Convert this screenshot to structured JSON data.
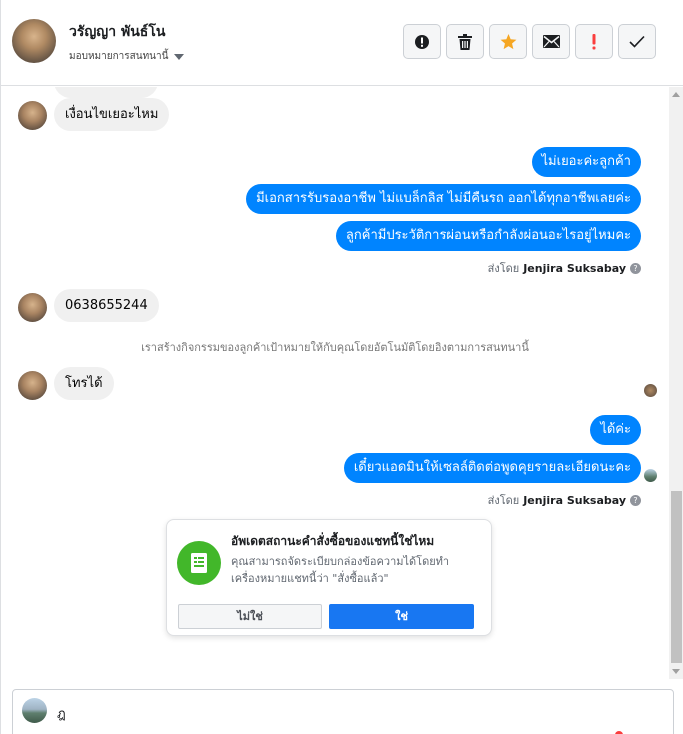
{
  "header": {
    "contact_name": "วรัญญา พันธ์โน",
    "assign_label": "มอบหมายการสนทนานี้"
  },
  "toolbar": {
    "buttons": [
      {
        "name": "spam-button",
        "icon": "alert-circle-icon"
      },
      {
        "name": "delete-button",
        "icon": "trash-icon"
      },
      {
        "name": "star-button",
        "icon": "star-icon",
        "color": "#f5a623"
      },
      {
        "name": "mark-unread-button",
        "icon": "envelope-icon"
      },
      {
        "name": "follow-up-button",
        "icon": "exclamation-icon",
        "color": "#fa3e3e"
      },
      {
        "name": "done-button",
        "icon": "checkmark-icon"
      }
    ]
  },
  "messages": {
    "in_1": "เงื่อนไขเยอะไหม",
    "out_1": "ไม่เยอะค่ะลูกค้า",
    "out_2": "มีเอกสารรับรองอาชีพ ไม่แบล็กลิส ไม่มีคืนรถ ออกได้ทุกอาชีพเลยค่ะ",
    "out_3": "ลูกค้ามีประวัติการผ่อนหรือกำลังผ่อนอะไรอยู่ไหมคะ",
    "sent_by_label_1": "ส่งโดย",
    "sent_by_name_1": "Jenjira Suksabay",
    "in_2": "0638655244",
    "system_note": "เราสร้างกิจกรรมของลูกค้าเป้าหมายให้กับคุณโดยอัตโนมัติโดยอิงตามการสนทนานี้",
    "in_3": "โทรได้",
    "out_4": "ได้ค่ะ",
    "out_5": "เดี๋ยวแอดมินให้เซลล์ติดต่อพูดคุยรายละเอียดนะคะ",
    "sent_by_label_2": "ส่งโดย",
    "sent_by_name_2": "Jenjira Suksabay"
  },
  "order_card": {
    "title": "อัพเดตสถานะคำสั่งซื้อของแชทนี้ใช่ไหม",
    "description": "คุณสามารถจัดระเบียบกล่องข้อความได้โดยทำเครื่องหมายแชทนี้ว่า \"สั่งซื้อแล้ว\"",
    "no_label": "ไม่ใช่",
    "yes_label": "ใช่",
    "icon": "receipt-icon",
    "icon_color": "#42b72a"
  },
  "composer": {
    "value": "ฎ"
  },
  "colors": {
    "outgoing_bubble": "#0084ff",
    "primary_button": "#1877f2"
  }
}
